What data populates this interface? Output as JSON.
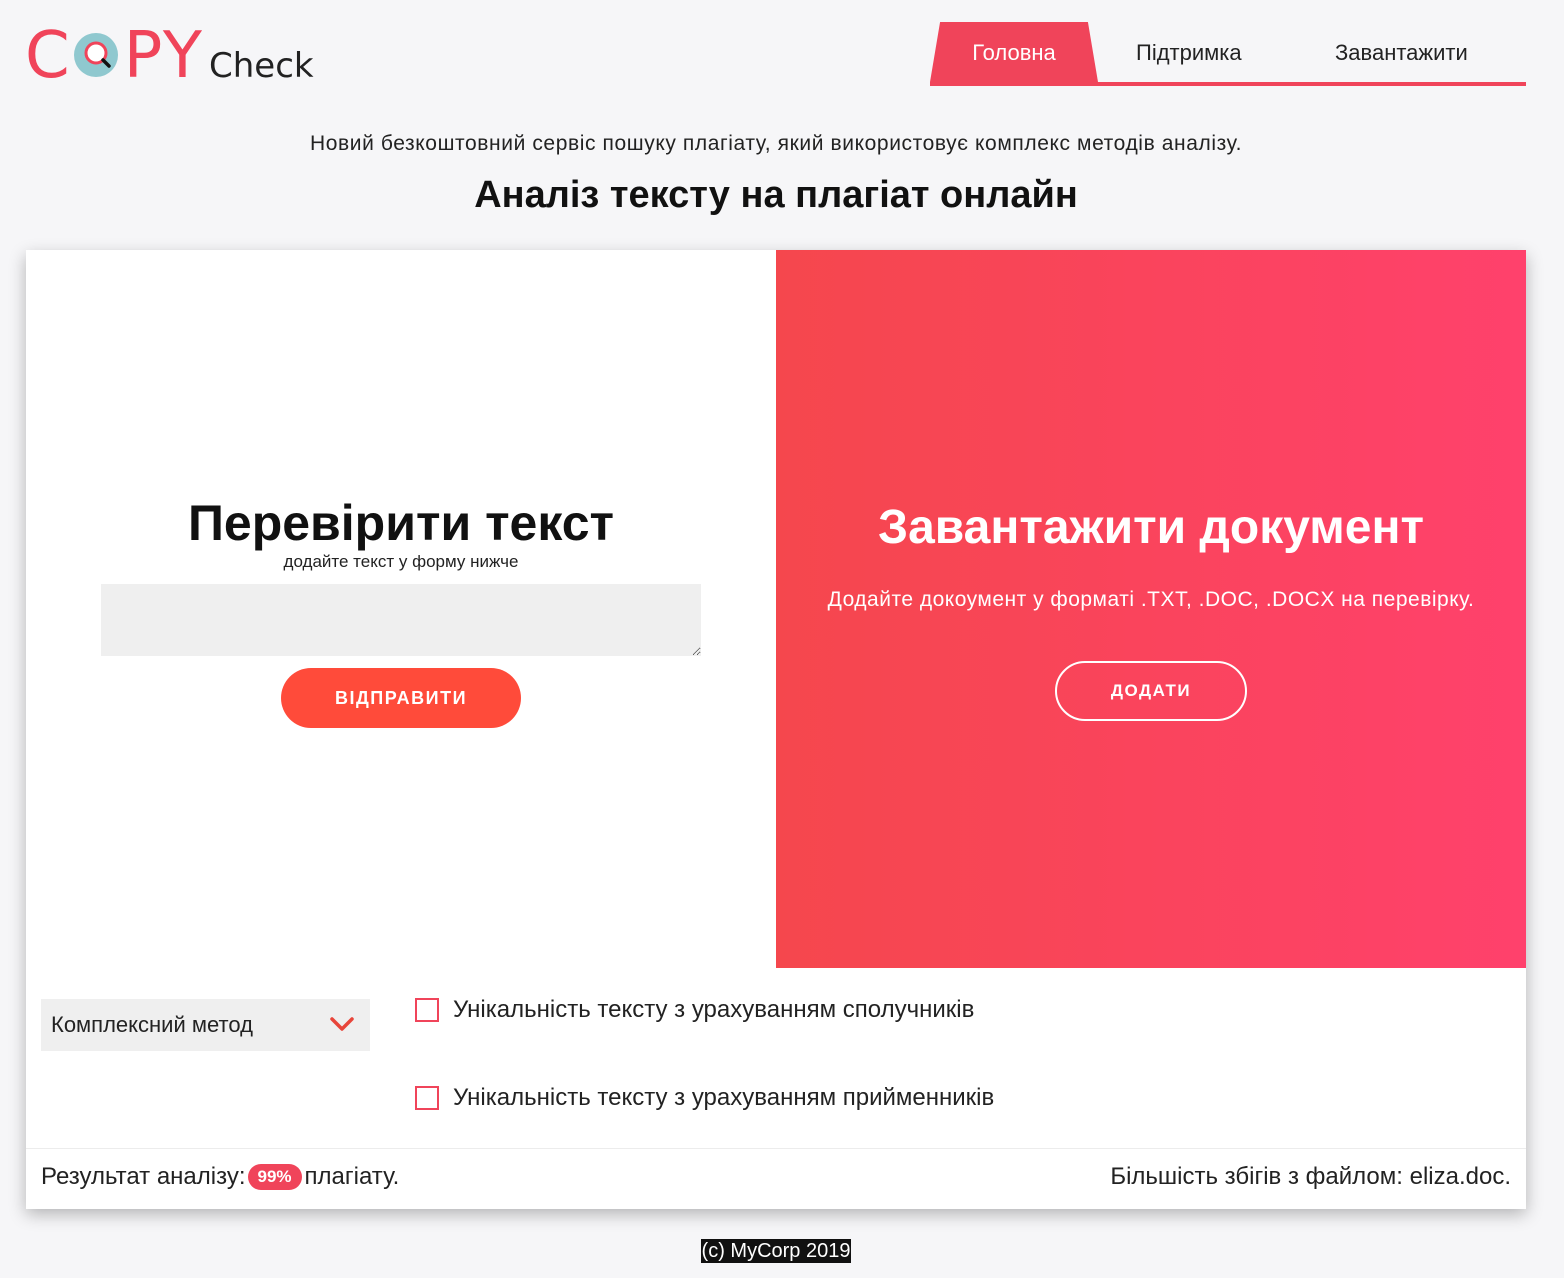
{
  "logo": {
    "c": "C",
    "py": "PY",
    "check": "Check",
    "colors": {
      "accent": "#f0445a",
      "lens": "#8fc8cf"
    }
  },
  "nav": {
    "items": [
      {
        "label": "Головна",
        "active": true
      },
      {
        "label": "Підтримка",
        "active": false
      },
      {
        "label": "Завантажити",
        "active": false
      }
    ]
  },
  "intro": {
    "subtitle": "Новий безкоштовний сервіс пошуку плагіату, який використовує комплекс методів аналізу.",
    "headline": "Аналіз тексту на плагіат онлайн"
  },
  "check_text": {
    "title": "Перевірити текст",
    "hint": "додайте текст у форму нижче",
    "textarea_value": "",
    "submit_label": "ВІДПРАВИТИ"
  },
  "upload": {
    "title": "Завантажити документ",
    "hint": "Додайте докоумент у форматі .TXT, .DOC, .DOCX на перевірку.",
    "button_label": "ДОДАТИ"
  },
  "options": {
    "method_select": "Комплексний метод",
    "checkboxes": [
      {
        "label": "Унікальність тексту з урахуванням сполучників",
        "checked": false
      },
      {
        "label": "Унікальність тексту з урахуванням прийменників",
        "checked": false
      }
    ]
  },
  "result": {
    "prefix": "Результат аналізу:",
    "percent": "99%",
    "suffix": "плагіату.",
    "match": "Більшість збігів з файлом: eliza.doc."
  },
  "footer": {
    "copyright": "(c) MyCorp 2019"
  },
  "colors": {
    "accent": "#f0445a",
    "button": "#ff4b3a",
    "gradient_start": "#f5474d",
    "gradient_end": "#ff416c"
  }
}
